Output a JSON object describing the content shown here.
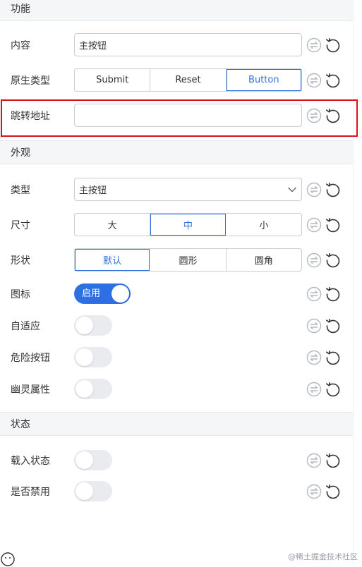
{
  "sections": {
    "function": {
      "title": "功能"
    },
    "appearance": {
      "title": "外观"
    },
    "state": {
      "title": "状态"
    }
  },
  "fields": {
    "content": {
      "label": "内容",
      "value": "主按钮"
    },
    "native_type": {
      "label": "原生类型",
      "options": [
        "Submit",
        "Reset",
        "Button"
      ],
      "selected": "Button"
    },
    "jump_url": {
      "label": "跳转地址",
      "value": ""
    },
    "type": {
      "label": "类型",
      "value": "主按钮"
    },
    "size": {
      "label": "尺寸",
      "options": [
        "大",
        "中",
        "小"
      ],
      "selected": "中"
    },
    "shape": {
      "label": "形状",
      "options": [
        "默认",
        "圆形",
        "圆角"
      ],
      "selected": "默认"
    },
    "icon": {
      "label": "图标",
      "toggle_on": true,
      "toggle_text": "启用"
    },
    "adaptive": {
      "label": "自适应",
      "toggle_on": false
    },
    "danger": {
      "label": "危险按钮",
      "toggle_on": false
    },
    "ghost": {
      "label": "幽灵属性",
      "toggle_on": false
    },
    "loading": {
      "label": "载入状态",
      "toggle_on": false
    },
    "disabled": {
      "label": "是否禁用",
      "toggle_on": false
    }
  },
  "colors": {
    "accent": "#2f6fe4",
    "highlight_border": "#d9111b",
    "section_bg": "#f5f6f8"
  },
  "icons": {
    "bind": "bind-variable-icon",
    "reset": "reset-icon"
  },
  "watermark": "@稀土掘金技术社区"
}
